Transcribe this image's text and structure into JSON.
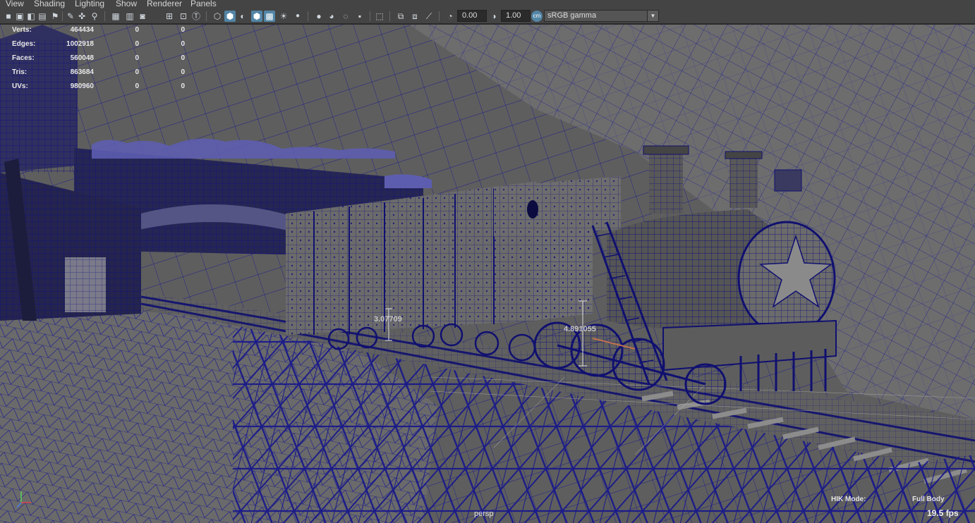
{
  "menu": [
    "View",
    "Shading",
    "Lighting",
    "Show",
    "Renderer",
    "Panels"
  ],
  "toolbar": {
    "exposure_value": "0.00",
    "gamma_value": "1.00",
    "color_space": "sRGB gamma"
  },
  "hud": {
    "rows": [
      {
        "label": "Verts:",
        "v1": "464434",
        "v2": "0",
        "v3": "0"
      },
      {
        "label": "Edges:",
        "v1": "1002918",
        "v2": "0",
        "v3": "0"
      },
      {
        "label": "Faces:",
        "v1": "560048",
        "v2": "0",
        "v3": "0"
      },
      {
        "label": "Tris:",
        "v1": "863684",
        "v2": "0",
        "v3": "0"
      },
      {
        "label": "UVs:",
        "v1": "980960",
        "v2": "0",
        "v3": "0"
      }
    ]
  },
  "measures": {
    "height": "3.07709",
    "length": "4.891055"
  },
  "viewport": {
    "camera": "persp",
    "hik_mode_label": "HIK Mode:",
    "hik_mode_value": "Full Body",
    "fps": "19.5 fps"
  },
  "colors": {
    "wireframe": "#1a1a8c",
    "background": "#6b6b6b",
    "ui_panel": "#444444",
    "active_button": "#5285a6"
  }
}
